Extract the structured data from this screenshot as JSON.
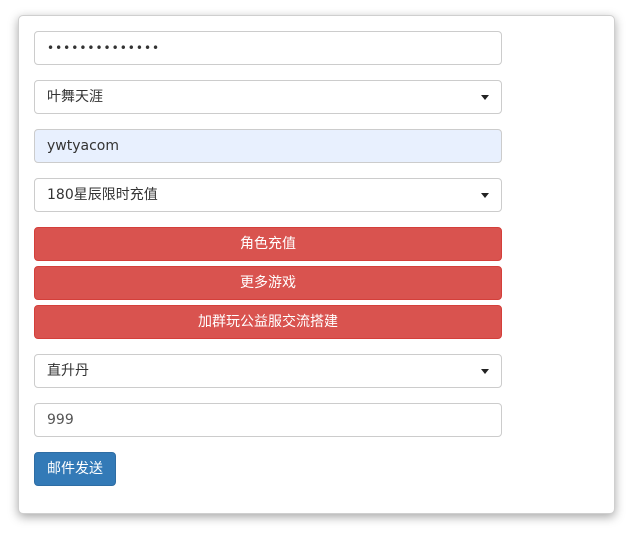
{
  "form": {
    "password_value": "••••••••••••••",
    "server_select": "叶舞天涯",
    "role_input": "ywtyacom",
    "package_select": "180星辰限时充值",
    "buttons": {
      "recharge": "角色充值",
      "more_games": "更多游戏",
      "join_group": "加群玩公益服交流搭建"
    },
    "item_select": "直升丹",
    "quantity_input": "999",
    "send_mail": "邮件发送"
  },
  "colors": {
    "danger": "#d9534f",
    "primary": "#337ab7",
    "autofill": "#e8f0fe"
  }
}
